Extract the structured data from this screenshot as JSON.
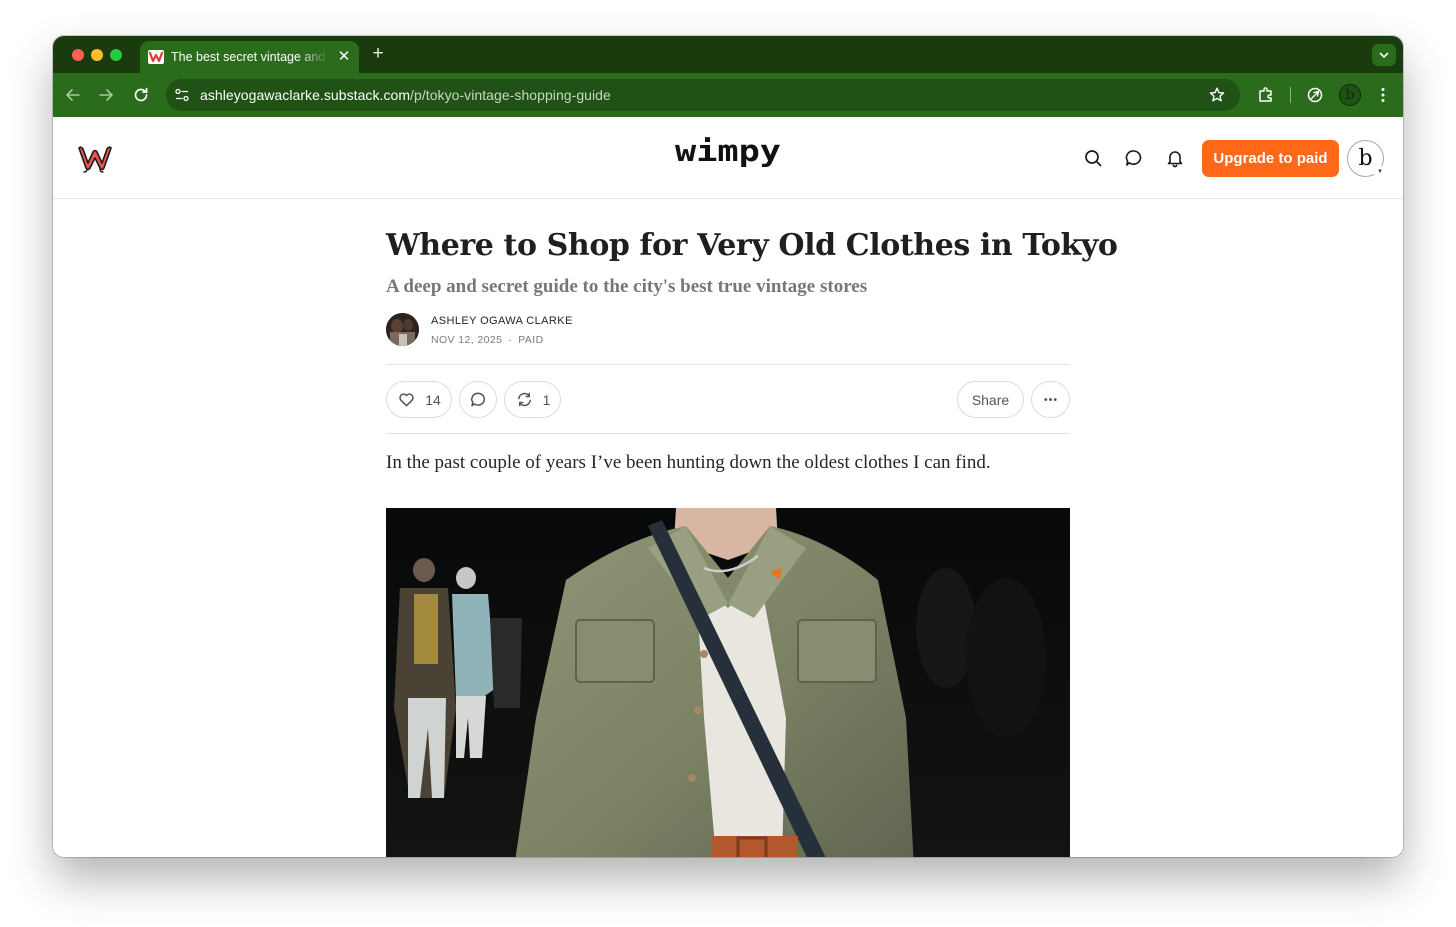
{
  "browser": {
    "tab": {
      "title": "The best secret vintage and antique clothing stores in Tokyo",
      "close_glyph": "✕"
    },
    "new_tab_glyph": "+",
    "address": {
      "host": "ashleyogawaclarke.substack.com",
      "path": "/p/tokyo-vintage-shopping-guide"
    },
    "profile_initial": "b"
  },
  "site": {
    "wordmark": "wimpy",
    "upgrade_label": "Upgrade to paid",
    "user_initial": "b",
    "caret_glyph": "▾",
    "accent_color": "#ff6719"
  },
  "post": {
    "title": "Where to Shop for Very Old Clothes in Tokyo",
    "subtitle": "A deep and secret guide to the city's best true vintage stores",
    "author": "ASHLEY OGAWA CLARKE",
    "date": "NOV 12, 2025",
    "meta_separator": "·",
    "access": "PAID",
    "likes": "14",
    "restacks": "1",
    "share_label": "Share",
    "first_paragraph": "In the past couple of years I’ve been hunting down the oldest clothes I can find."
  },
  "icons": {
    "browser": [
      "back-arrow-icon",
      "forward-arrow-icon",
      "reload-icon",
      "site-info-icon",
      "bookmark-star-icon",
      "extensions-icon",
      "performance-icon",
      "kebab-menu-icon",
      "tab-dropdown-icon"
    ],
    "site": [
      "search-icon",
      "chat-icon",
      "bell-icon",
      "heart-icon",
      "comment-icon",
      "restack-icon",
      "ellipsis-icon"
    ]
  }
}
